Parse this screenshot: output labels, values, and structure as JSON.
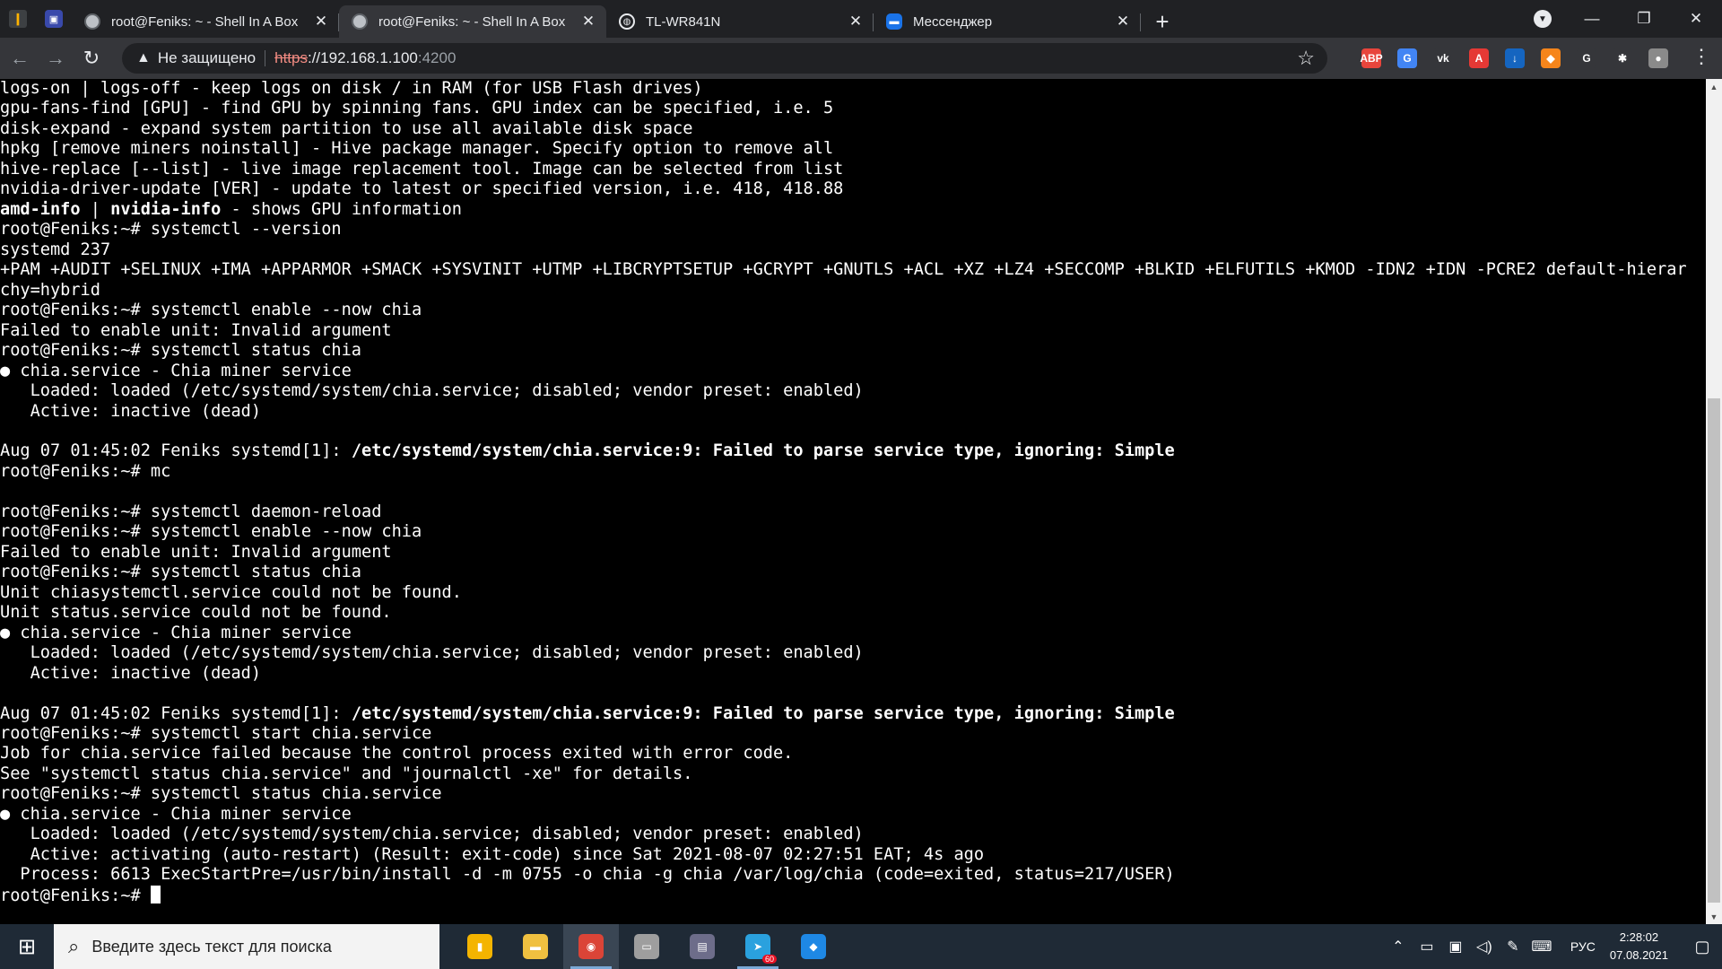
{
  "browser": {
    "pinned": [
      {
        "icon": "extension-app-icon",
        "glyph": "❙"
      },
      {
        "icon": "document-app-icon",
        "glyph": "▣"
      }
    ],
    "tabs": [
      {
        "title": "root@Feniks: ~ - Shell In A Box",
        "icon": "shellinabox-icon",
        "active": false
      },
      {
        "title": "root@Feniks: ~ - Shell In A Box",
        "icon": "shellinabox-icon",
        "active": true
      },
      {
        "title": "TL-WR841N",
        "icon": "globe-icon",
        "active": false
      },
      {
        "title": "Мессенджер",
        "icon": "messenger-icon",
        "active": false
      }
    ],
    "not_secure_label": "Не защищено",
    "url": {
      "scheme": "https",
      "rest": "://192.168.1.100",
      "port": ":4200"
    },
    "extensions": [
      {
        "name": "adblock-icon",
        "label": "ABP",
        "color": "#e8453c"
      },
      {
        "name": "translate-icon",
        "label": "G",
        "color": "#4285f4"
      },
      {
        "name": "vk-icon",
        "label": "vk",
        "color": "#35363a"
      },
      {
        "name": "a-extension-icon",
        "label": "A",
        "color": "#e53935"
      },
      {
        "name": "download-extension-icon",
        "label": "↓",
        "color": "#1565c0"
      },
      {
        "name": "metamask-icon",
        "label": "◆",
        "color": "#f6851b"
      },
      {
        "name": "grammarly-icon",
        "label": "G",
        "color": "#35363a"
      },
      {
        "name": "extensions-puzzle-icon",
        "label": "✱",
        "color": "#35363a"
      },
      {
        "name": "profile-avatar-icon",
        "label": "●",
        "color": "#8a8a8a"
      }
    ]
  },
  "terminal": {
    "lines": [
      {
        "text": "logs-on | logs-off - keep logs on disk / in RAM (for USB Flash drives)"
      },
      {
        "text": "gpu-fans-find [GPU] - find GPU by spinning fans. GPU index can be specified, i.e. 5"
      },
      {
        "text": "disk-expand - expand system partition to use all available disk space"
      },
      {
        "text": "hpkg [remove miners noinstall] - Hive package manager. Specify option to remove all"
      },
      {
        "text": "hive-replace [--list] - live image replacement tool. Image can be selected from list"
      },
      {
        "text": "nvidia-driver-update [VER] - update to latest or specified version, i.e. 418, 418.88"
      },
      {
        "text": "",
        "parts": [
          {
            "t": "amd-info",
            "b": true
          },
          {
            "t": " | "
          },
          {
            "t": "nvidia-info",
            "b": true
          },
          {
            "t": " - shows GPU information"
          }
        ]
      },
      {
        "text": "root@Feniks:~# systemctl --version"
      },
      {
        "text": "systemd 237"
      },
      {
        "text": "+PAM +AUDIT +SELINUX +IMA +APPARMOR +SMACK +SYSVINIT +UTMP +LIBCRYPTSETUP +GCRYPT +GNUTLS +ACL +XZ +LZ4 +SECCOMP +BLKID +ELFUTILS +KMOD -IDN2 +IDN -PCRE2 default-hierar"
      },
      {
        "text": "chy=hybrid"
      },
      {
        "text": "root@Feniks:~# systemctl enable --now chia"
      },
      {
        "text": "Failed to enable unit: Invalid argument"
      },
      {
        "text": "root@Feniks:~# systemctl status chia"
      },
      {
        "text": "● chia.service - Chia miner service"
      },
      {
        "text": "   Loaded: loaded (/etc/systemd/system/chia.service; disabled; vendor preset: enabled)"
      },
      {
        "text": "   Active: inactive (dead)"
      },
      {
        "text": ""
      },
      {
        "text": "",
        "parts": [
          {
            "t": "Aug 07 01:45:02 Feniks systemd[1]: "
          },
          {
            "t": "/etc/systemd/system/chia.service:9: Failed to parse service type, ignoring: Simple",
            "b": true
          }
        ]
      },
      {
        "text": "root@Feniks:~# mc"
      },
      {
        "text": ""
      },
      {
        "text": "root@Feniks:~# systemctl daemon-reload"
      },
      {
        "text": "root@Feniks:~# systemctl enable --now chia"
      },
      {
        "text": "Failed to enable unit: Invalid argument"
      },
      {
        "text": "root@Feniks:~# systemctl status chia"
      },
      {
        "text": "Unit chiasystemctl.service could not be found."
      },
      {
        "text": "Unit status.service could not be found."
      },
      {
        "text": "● chia.service - Chia miner service"
      },
      {
        "text": "   Loaded: loaded (/etc/systemd/system/chia.service; disabled; vendor preset: enabled)"
      },
      {
        "text": "   Active: inactive (dead)"
      },
      {
        "text": ""
      },
      {
        "text": "",
        "parts": [
          {
            "t": "Aug 07 01:45:02 Feniks systemd[1]: "
          },
          {
            "t": "/etc/systemd/system/chia.service:9: Failed to parse service type, ignoring: Simple",
            "b": true
          }
        ]
      },
      {
        "text": "root@Feniks:~# systemctl start chia.service"
      },
      {
        "text": "Job for chia.service failed because the control process exited with error code."
      },
      {
        "text": "See \"systemctl status chia.service\" and \"journalctl -xe\" for details."
      },
      {
        "text": "root@Feniks:~# systemctl status chia.service"
      },
      {
        "text": "● chia.service - Chia miner service"
      },
      {
        "text": "   Loaded: loaded (/etc/systemd/system/chia.service; disabled; vendor preset: enabled)"
      },
      {
        "text": "   Active: activating (auto-restart) (Result: exit-code) since Sat 2021-08-07 02:27:51 EAT; 4s ago"
      },
      {
        "text": "  Process: 6613 ExecStartPre=/usr/bin/install -d -m 0755 -o chia -g chia /var/log/chia (code=exited, status=217/USER)"
      }
    ],
    "prompt": "root@Feniks:~# "
  },
  "taskbar": {
    "search_placeholder": "Введите здесь текст для поиска",
    "apps": [
      {
        "name": "file-app-icon",
        "glyph": "▮",
        "color": "#f4b400",
        "state": ""
      },
      {
        "name": "file-explorer-icon",
        "glyph": "▬",
        "color": "#f0c040",
        "state": ""
      },
      {
        "name": "chrome-icon",
        "glyph": "◉",
        "color": "#db4437",
        "state": "active running"
      },
      {
        "name": "scanner-app-icon",
        "glyph": "▭",
        "color": "#9e9e9e",
        "state": ""
      },
      {
        "name": "winrar-icon",
        "glyph": "▤",
        "color": "#6d6d8a",
        "state": ""
      },
      {
        "name": "telegram-icon",
        "glyph": "➤",
        "color": "#2aa1de",
        "state": "running",
        "badge": "60"
      },
      {
        "name": "diamond-app-icon",
        "glyph": "◆",
        "color": "#1e88e5",
        "state": ""
      }
    ],
    "lang": "РУС",
    "time": "2:28:02",
    "date": "07.08.2021"
  }
}
